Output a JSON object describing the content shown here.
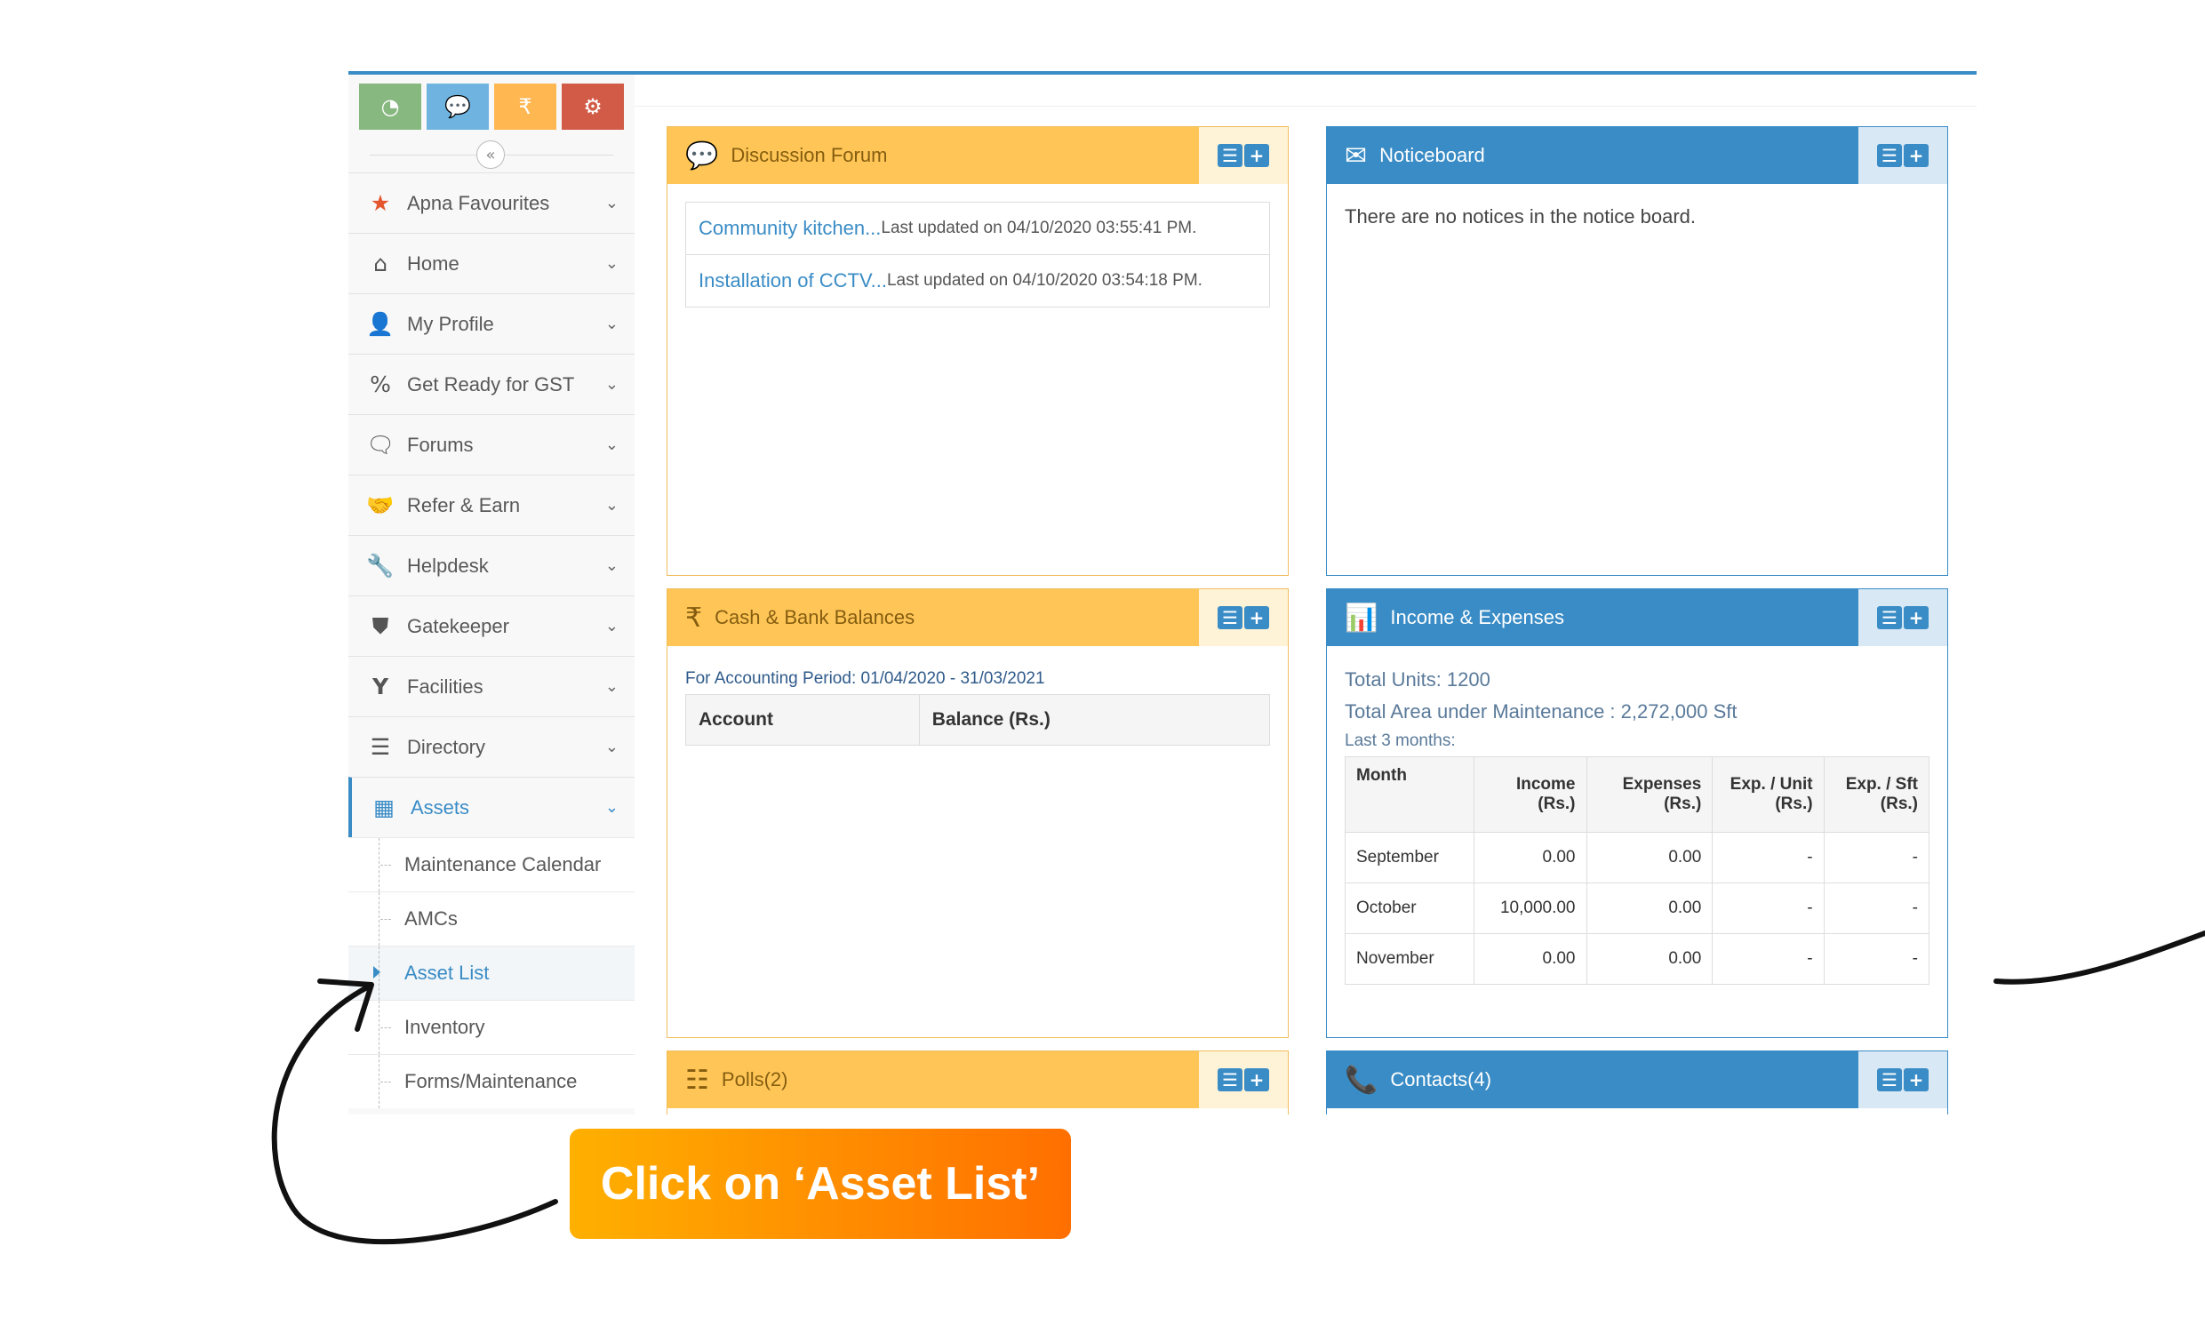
{
  "shortcuts": [
    {
      "icon": "dashboard-icon",
      "glyph": "◔",
      "color": "#87b87f"
    },
    {
      "icon": "chat-icon",
      "glyph": "💬",
      "color": "#6fb3e0"
    },
    {
      "icon": "rupee-icon",
      "glyph": "₹",
      "color": "#ffb752"
    },
    {
      "icon": "cogs-icon",
      "glyph": "⚙",
      "color": "#d15b47"
    }
  ],
  "collapse_glyph": "«",
  "menu": [
    {
      "label": "Apna Favourites",
      "glyph": "★",
      "icon": "star-icon",
      "color": "#e4572e"
    },
    {
      "label": "Home",
      "glyph": "⌂",
      "icon": "home-icon"
    },
    {
      "label": "My Profile",
      "glyph": "👤",
      "icon": "user-icon"
    },
    {
      "label": "Get Ready for GST",
      "glyph": "%",
      "icon": "percent-icon"
    },
    {
      "label": "Forums",
      "glyph": "🗨",
      "icon": "comments-icon"
    },
    {
      "label": "Refer & Earn",
      "glyph": "🤝",
      "icon": "handshake-icon"
    },
    {
      "label": "Helpdesk",
      "glyph": "🔧",
      "icon": "wrench-icon"
    },
    {
      "label": "Gatekeeper",
      "glyph": "⛊",
      "icon": "shield-icon"
    },
    {
      "label": "Facilities",
      "glyph": "Y",
      "icon": "glass-icon"
    },
    {
      "label": "Directory",
      "glyph": "☰",
      "icon": "list-icon"
    },
    {
      "label": "Assets",
      "glyph": "▦",
      "icon": "building-icon"
    }
  ],
  "chevron": "⌄",
  "submenu": [
    {
      "label": "Maintenance Calendar"
    },
    {
      "label": "AMCs"
    },
    {
      "label": "Asset List"
    },
    {
      "label": "Inventory"
    },
    {
      "label": "Forms/Maintenance"
    }
  ],
  "widgets": {
    "discussion": {
      "title": "Discussion Forum",
      "glyph": "💬",
      "rows": [
        {
          "link": "Community kitchen...",
          "meta": "Last updated on 04/10/2020 03:55:41 PM."
        },
        {
          "link": "Installation of CCTV...",
          "meta": "Last updated on 04/10/2020 03:54:18 PM."
        }
      ]
    },
    "noticeboard": {
      "title": "Noticeboard",
      "glyph": "✉",
      "text": "There are no notices in the notice board."
    },
    "cash": {
      "title": "Cash & Bank Balances",
      "glyph": "₹",
      "period": "For Accounting Period: 01/04/2020 - 31/03/2021",
      "headers": [
        "Account",
        "Balance (Rs.)"
      ]
    },
    "income": {
      "title": "Income & Expenses",
      "glyph": "📊",
      "total_units": "Total Units: 1200",
      "total_area": "Total Area under Maintenance : 2,272,000 Sft",
      "last_label": "Last 3 months:",
      "headers": [
        "Month",
        "Income (Rs.)",
        "Expenses (Rs.)",
        "Exp. / Unit (Rs.)",
        "Exp. / Sft (Rs.)"
      ],
      "rows": [
        [
          "September",
          "0.00",
          "0.00",
          "-",
          "-"
        ],
        [
          "October",
          "10,000.00",
          "0.00",
          "-",
          "-"
        ],
        [
          "November",
          "0.00",
          "0.00",
          "-",
          "-"
        ]
      ]
    },
    "polls": {
      "title": "Polls(2)",
      "glyph": "☷"
    },
    "contacts": {
      "title": "Contacts(4)",
      "glyph": "📞"
    }
  },
  "tool_list_glyph": "☰",
  "tool_add_glyph": "+",
  "callout": "Click on ‘Asset List’",
  "colors": {
    "accent": "#3a8cc6",
    "orange_header": "#ffc657"
  }
}
